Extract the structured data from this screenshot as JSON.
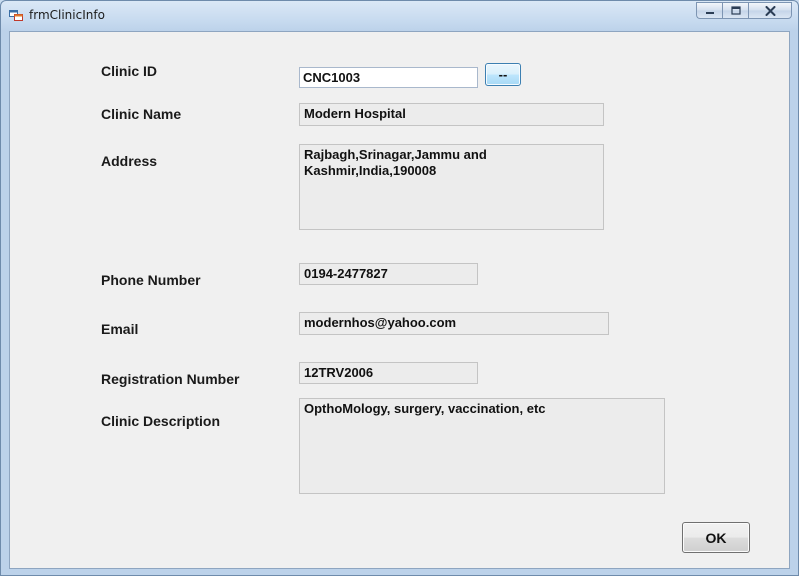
{
  "window": {
    "title": "frmClinicInfo"
  },
  "form": {
    "clinic_id": {
      "label": "Clinic ID",
      "value": "CNC1003",
      "browse_label": "--"
    },
    "clinic_name": {
      "label": "Clinic Name",
      "value": "Modern Hospital"
    },
    "address": {
      "label": "Address",
      "value": "Rajbagh,Srinagar,Jammu and\nKashmir,India,190008"
    },
    "phone_number": {
      "label": "Phone Number",
      "value": "0194-2477827"
    },
    "email": {
      "label": "Email",
      "value": "modernhos@yahoo.com"
    },
    "registration_number": {
      "label": "Registration Number",
      "value": "12TRV2006"
    },
    "clinic_description": {
      "label": "Clinic Description",
      "value": "OpthoMology, surgery, vaccination, etc"
    }
  },
  "buttons": {
    "ok_label": "OK"
  },
  "icons": {
    "app": "app-form-icon",
    "minimize": "minimize-icon",
    "maximize": "maximize-icon",
    "close": "close-icon"
  },
  "colors": {
    "client_background": "#f0f0f0",
    "readonly_field": "#ececec",
    "browse_button_accent": "#3c7fb1"
  }
}
